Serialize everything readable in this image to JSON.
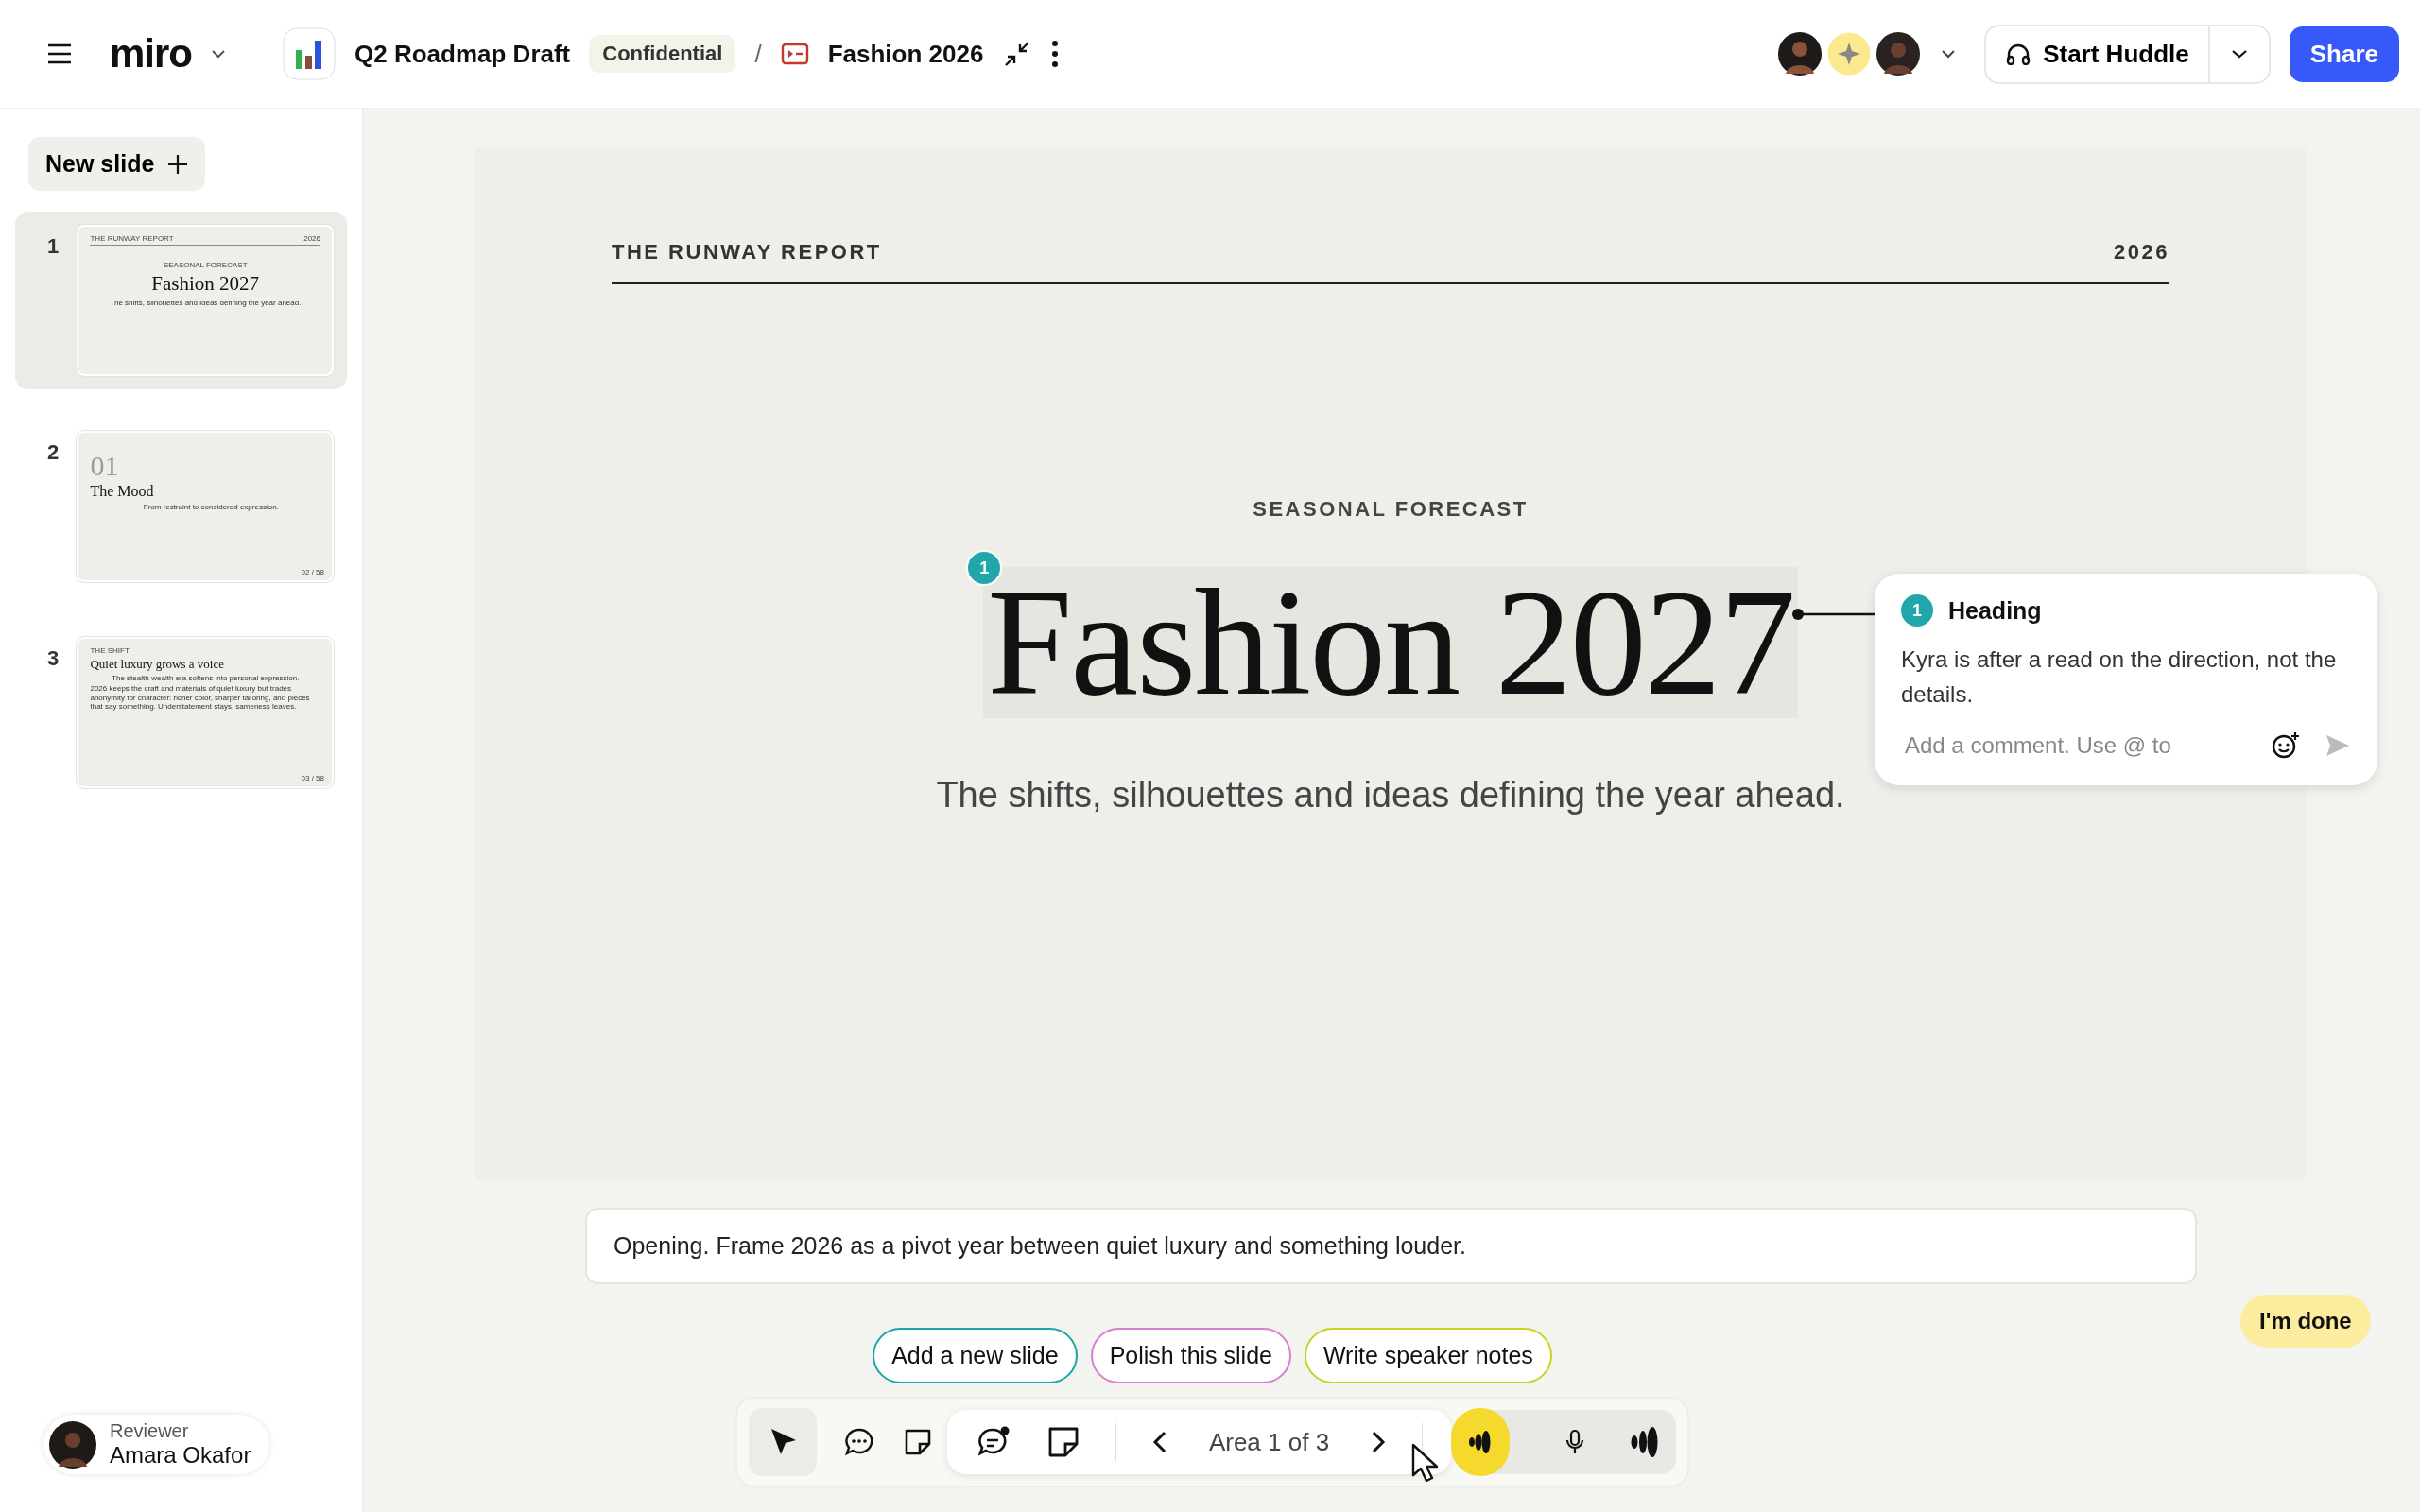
{
  "topbar": {
    "logo": "miro",
    "board": "Q2 Roadmap Draft",
    "tag": "Confidential",
    "separator": "/",
    "frame": "Fashion 2026",
    "huddle": "Start Huddle",
    "share": "Share"
  },
  "sidebar": {
    "new_slide": "New slide",
    "slides": [
      {
        "number": "1",
        "kind": "title",
        "selected": true,
        "eyebrow": "THE RUNWAY REPORT",
        "year": "2026",
        "kicker": "SEASONAL FORECAST",
        "title": "Fashion 2027",
        "subtitle": "The shifts, silhouettes and ideas defining the year ahead."
      },
      {
        "number": "2",
        "kind": "section",
        "selected": false,
        "index": "01",
        "title": "The Mood",
        "subtitle": "From restraint to considered expression.",
        "page": "02 / 58"
      },
      {
        "number": "3",
        "kind": "text",
        "selected": false,
        "eyebrow": "THE SHIFT",
        "title": "Quiet luxury grows a voice",
        "subtitle": "The stealth-wealth era softens into personal expression.",
        "body": "2026 keeps the craft and materials of quiet luxury but trades anonymity for character: richer color, sharper tailoring, and pieces that say something. Understatement stays, sameness leaves.",
        "page": "03 / 58"
      }
    ],
    "reviewer": {
      "role": "Reviewer",
      "name": "Amara Okafor"
    }
  },
  "slide": {
    "eyebrow": "THE RUNWAY REPORT",
    "year": "2026",
    "kicker": "SEASONAL FORECAST",
    "title": "Fashion 2027",
    "title_badge": "1",
    "subtitle": "The shifts, silhouettes and ideas defining the year ahead."
  },
  "comment": {
    "badge": "1",
    "title": "Heading",
    "text": "Kyra is after a read on the direction, not the details.",
    "placeholder": "Add a comment. Use @ to"
  },
  "notes": "Opening. Frame 2026 as a pivot year between quiet luxury and something louder.",
  "suggestions": [
    {
      "label": "Add a new slide",
      "color": "#1fa3a8"
    },
    {
      "label": "Polish this slide",
      "color": "#d47fd0"
    },
    {
      "label": "Write speaker notes",
      "color": "#c9d21c"
    }
  ],
  "toolbar": {
    "select_selected": true,
    "area": "Area 1 of 3"
  },
  "done_button": "I'm done"
}
